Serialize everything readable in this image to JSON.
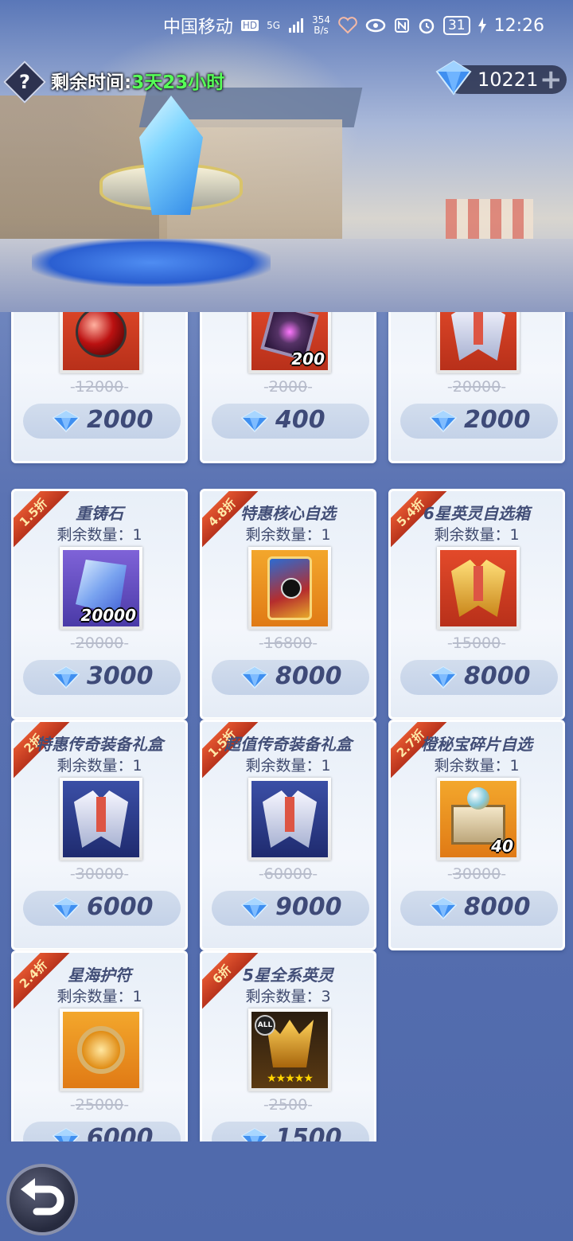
{
  "status_bar": {
    "carrier": "中国移动",
    "hd": "HD",
    "network": "5G",
    "speed_value": "354",
    "speed_unit": "B/s",
    "battery": "31",
    "time": "12:26"
  },
  "header": {
    "help_label": "?",
    "time_label": "剩余时间:",
    "time_value": "3天23小时",
    "currency_amount": "10221",
    "plus_label": "+"
  },
  "items": [
    {
      "name": "",
      "remain": "",
      "qty": "",
      "old_price": "12000",
      "price": "2000",
      "discount": "",
      "art": "orb"
    },
    {
      "name": "",
      "remain": "",
      "qty": "200",
      "old_price": "2000",
      "price": "400",
      "discount": "",
      "art": "cube"
    },
    {
      "name": "",
      "remain": "",
      "qty": "",
      "old_price": "20000",
      "price": "2000",
      "discount": "",
      "art": "armor"
    },
    {
      "name": "重铸石",
      "remain": "剩余数量：1",
      "qty": "20000",
      "old_price": "20000",
      "price": "3000",
      "discount": "1.5折",
      "art": "shard"
    },
    {
      "name": "特惠核心自选",
      "remain": "剩余数量：1",
      "qty": "",
      "old_price": "16800",
      "price": "8000",
      "discount": "4.8折",
      "art": "card"
    },
    {
      "name": "6星英灵自选箱",
      "remain": "剩余数量：1",
      "qty": "",
      "old_price": "15000",
      "price": "8000",
      "discount": "5.4折",
      "art": "armor-gold"
    },
    {
      "name": "特惠传奇装备礼盒",
      "remain": "剩余数量：1",
      "qty": "",
      "old_price": "30000",
      "price": "6000",
      "discount": "2折",
      "art": "armor-blue"
    },
    {
      "name": "超值传奇装备礼盒",
      "remain": "剩余数量：1",
      "qty": "",
      "old_price": "60000",
      "price": "9000",
      "discount": "1.5折",
      "art": "armor-blue"
    },
    {
      "name": "橙秘宝碎片自选",
      "remain": "剩余数量：1",
      "qty": "40",
      "old_price": "30000",
      "price": "8000",
      "discount": "2.7折",
      "art": "chest"
    },
    {
      "name": "星海护符",
      "remain": "剩余数量：1",
      "qty": "",
      "old_price": "25000",
      "price": "6000",
      "discount": "2.4折",
      "art": "amulet"
    },
    {
      "name": "5星全系英灵",
      "remain": "剩余数量：3",
      "qty": "",
      "old_price": "2500",
      "price": "1500",
      "discount": "6折",
      "art": "mask"
    }
  ],
  "special_badges": {
    "all": "ALL",
    "stars": "★★★★★"
  },
  "icons": {
    "help": "question-mark-icon",
    "currency": "diamond-gem-icon",
    "back": "back-arrow-icon"
  },
  "colors": {
    "time_value": "#56ff58",
    "discount_ribbon": "#d2452a",
    "price_text": "#3e4a78"
  }
}
